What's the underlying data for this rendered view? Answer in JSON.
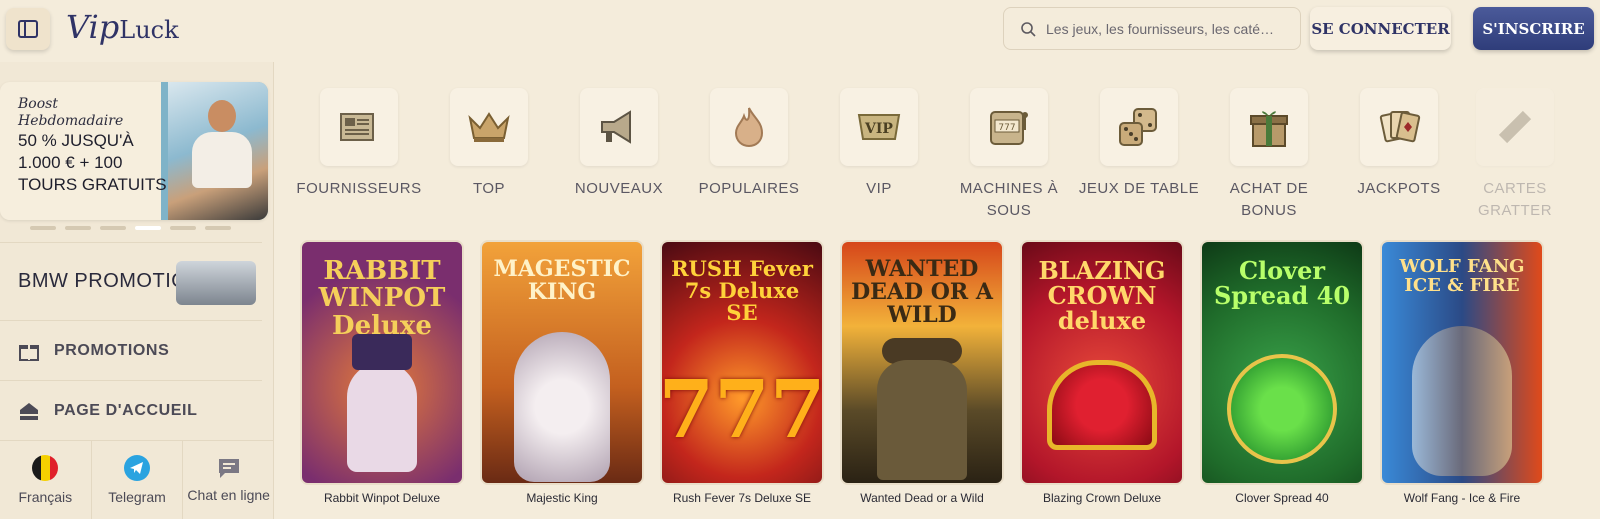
{
  "header": {
    "logo_script": "Vip",
    "logo_text": "Luck",
    "search_placeholder": "Les jeux, les fournisseurs, les caté…",
    "login_label": "SE CONNECTER",
    "signup_label": "S'INSCRIRE"
  },
  "sidebar": {
    "promo": {
      "line1": "Boost",
      "line2": "Hebdomadaire",
      "line3": "50 % JUSQU'À",
      "line4": "1.000 € + 100",
      "line5": "TOURS GRATUITS"
    },
    "bmw_label": "BMW PROMOTION",
    "items": [
      {
        "label": "PROMOTIONS",
        "icon": "gift-icon"
      },
      {
        "label": "PAGE D'ACCUEIL",
        "icon": "home-icon"
      }
    ],
    "footer": [
      {
        "label": "Français",
        "icon": "belgium-flag-icon"
      },
      {
        "label": "Telegram",
        "icon": "telegram-icon"
      },
      {
        "label": "Chat en ligne",
        "icon": "chat-icon"
      }
    ]
  },
  "categories": [
    {
      "label": "FOURNISSEURS",
      "icon": "newspaper-icon"
    },
    {
      "label": "TOP",
      "icon": "crown-icon"
    },
    {
      "label": "NOUVEAUX",
      "icon": "megaphone-icon"
    },
    {
      "label": "POPULAIRES",
      "icon": "flame-icon"
    },
    {
      "label": "VIP",
      "icon": "vip-icon"
    },
    {
      "label": "MACHINES À SOUS",
      "icon": "slot-machine-icon"
    },
    {
      "label": "JEUX DE TABLE",
      "icon": "dice-icon"
    },
    {
      "label": "ACHAT DE BONUS",
      "icon": "gift-box-icon"
    },
    {
      "label": "JACKPOTS",
      "icon": "cards-icon"
    },
    {
      "label": "CARTES GRATTER",
      "icon": "scratch-icon"
    }
  ],
  "games": [
    {
      "name": "Rabbit Winpot Deluxe",
      "art": "RABBIT WINPOT Deluxe",
      "bg": "#7a2e6e"
    },
    {
      "name": "Majestic King",
      "art": "MAGESTIC KING",
      "bg": "#c4601f"
    },
    {
      "name": "Rush Fever 7s Deluxe SE",
      "art": "RUSH Fever 7s Deluxe SE",
      "bg": "#8a1a1e"
    },
    {
      "name": "Wanted Dead or a Wild",
      "art": "WANTED DEAD OR A WILD",
      "bg": "#5a4a28"
    },
    {
      "name": "Blazing Crown Deluxe",
      "art": "BLAZING CROWN deluxe",
      "bg": "#b3162a"
    },
    {
      "name": "Clover Spread 40",
      "art": "Clover Spread 40",
      "bg": "#1f6b2a"
    },
    {
      "name": "Wolf Fang - Ice & Fire",
      "art": "WOLF FANG ICE & FIRE",
      "bg": "#2b4a86"
    }
  ]
}
